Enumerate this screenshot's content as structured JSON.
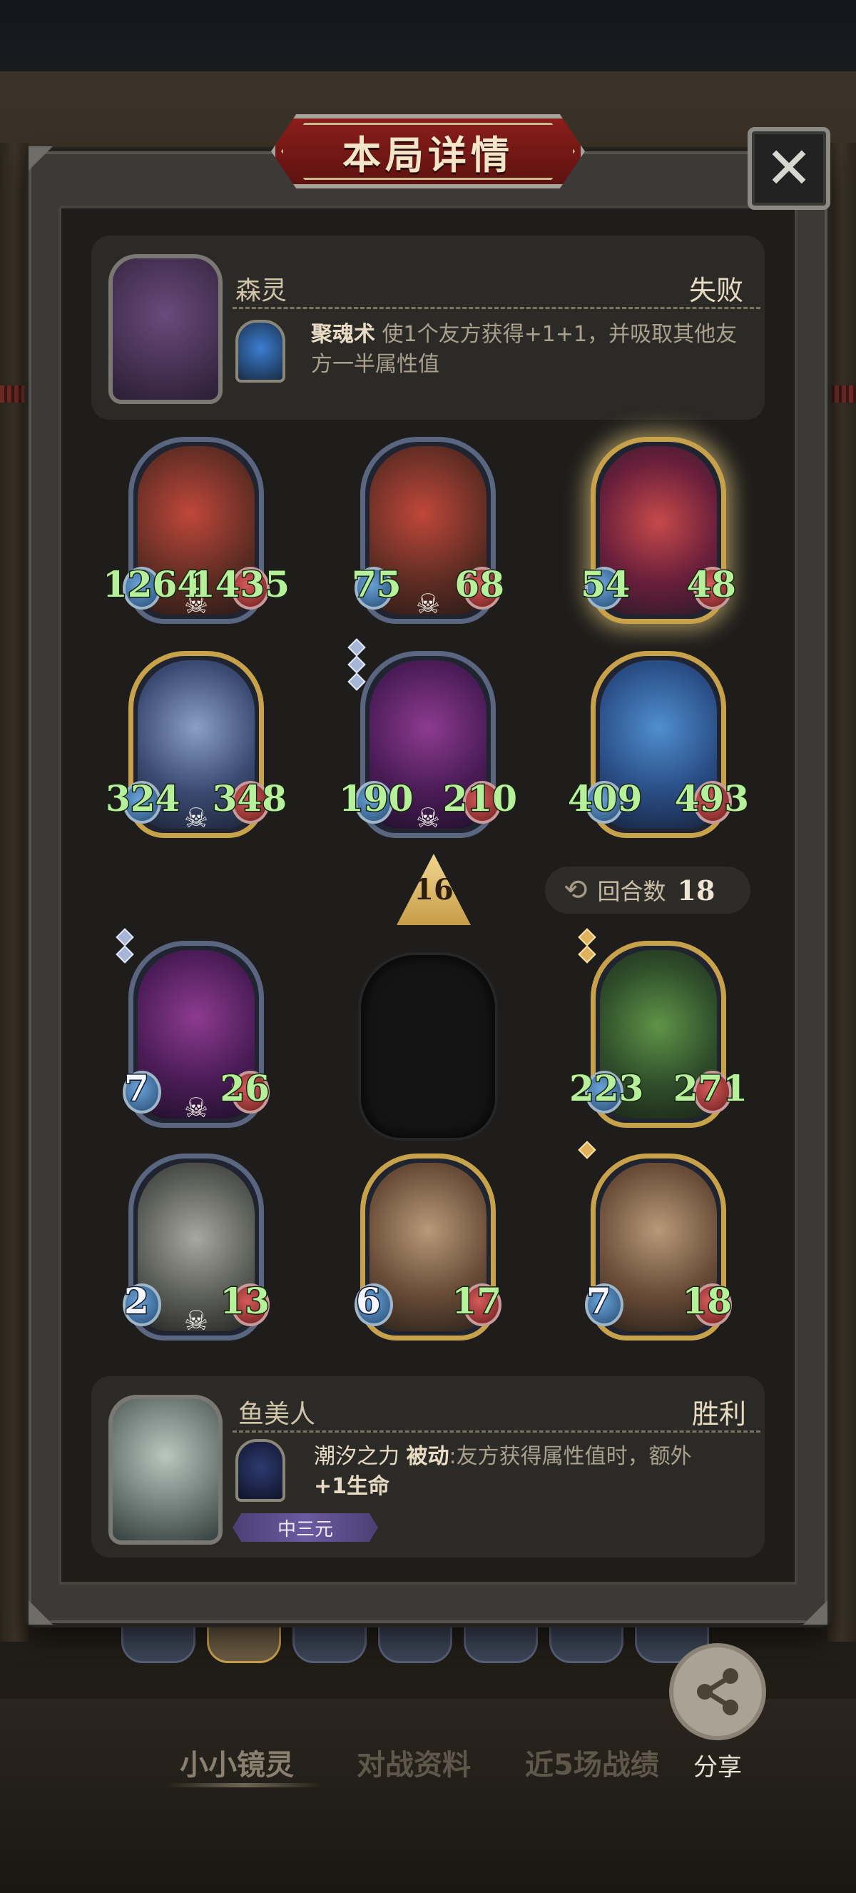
{
  "dialog": {
    "title": "本局详情",
    "close_icon": "close-icon"
  },
  "opponent": {
    "name": "森灵",
    "result": "失败",
    "skill_name": "聚魂术",
    "skill_desc_1": "使1个友方获得+1+1，并吸取其他友",
    "skill_desc_2": "方一半属性值"
  },
  "opponent_board": [
    {
      "attack": "1264",
      "health": "1435",
      "skull": true
    },
    {
      "attack": "75",
      "health": "68",
      "skull": true
    },
    {
      "attack": "54",
      "health": "48",
      "skull": false
    },
    {
      "attack": "324",
      "health": "348",
      "skull": true
    },
    {
      "attack": "190",
      "health": "210",
      "skull": true
    },
    {
      "attack": "409",
      "health": "493",
      "skull": false
    }
  ],
  "level": "16",
  "rounds": {
    "label": "回合数",
    "value": "18"
  },
  "player_board": [
    {
      "attack": "7",
      "health": "26",
      "skull": true
    },
    {
      "attack": "223",
      "health": "271",
      "skull": false
    },
    {
      "attack": "2",
      "health": "13",
      "skull": true
    },
    {
      "attack": "6",
      "health": "17",
      "skull": false
    },
    {
      "attack": "7",
      "health": "18",
      "skull": false
    }
  ],
  "player": {
    "name": "鱼美人",
    "result": "胜利",
    "skill_name": "潮汐之力",
    "skill_type": "被动",
    "skill_desc_1": ":友方获得属性值时，额外",
    "skill_desc_2": "+1生命",
    "badge": "中三元"
  },
  "bottom_tabs": [
    "小小镜灵",
    "对战资料",
    "近5场战绩"
  ],
  "share_label": "分享",
  "colors": {
    "stat_green": "#b7f09a",
    "title_red": "#8a1e1b",
    "gold_frame": "#c8a14b"
  }
}
